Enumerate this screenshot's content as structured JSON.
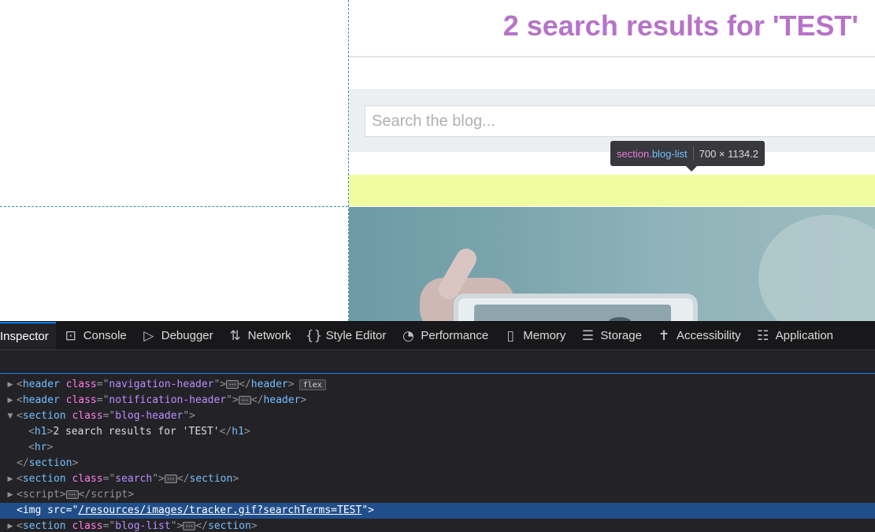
{
  "page": {
    "blog_title": "2 search results for 'TEST'",
    "search_placeholder": "Search the blog..."
  },
  "tooltip": {
    "tag": "section",
    "class": ".blog-list",
    "dimensions": "700 × 1134.2"
  },
  "devtools": {
    "tabs": [
      {
        "label": "Inspector",
        "icon": "inspector-icon",
        "active": true
      },
      {
        "label": "Console",
        "icon": "console-icon"
      },
      {
        "label": "Debugger",
        "icon": "debugger-icon"
      },
      {
        "label": "Network",
        "icon": "network-icon"
      },
      {
        "label": "Style Editor",
        "icon": "style-editor-icon"
      },
      {
        "label": "Performance",
        "icon": "performance-icon"
      },
      {
        "label": "Memory",
        "icon": "memory-icon"
      },
      {
        "label": "Storage",
        "icon": "storage-icon"
      },
      {
        "label": "Accessibility",
        "icon": "accessibility-icon"
      },
      {
        "label": "Application",
        "icon": "application-icon"
      }
    ],
    "markup": {
      "nav_header": {
        "tag": "header",
        "attr": "class",
        "value": "navigation-header",
        "badge": "flex"
      },
      "notif_header": {
        "tag": "header",
        "attr": "class",
        "value": "notification-header"
      },
      "blog_header": {
        "tag": "section",
        "attr": "class",
        "value": "blog-header"
      },
      "h1": {
        "tag": "h1",
        "text": "2 search results for 'TEST'"
      },
      "hr": {
        "tag": "hr"
      },
      "section_close": "section",
      "search_section": {
        "tag": "section",
        "attr": "class",
        "value": "search"
      },
      "script": {
        "tag": "script"
      },
      "img": {
        "tag": "img",
        "attr": "src",
        "value": "/resources/images/tracker.gif?searchTerms=TEST"
      },
      "blog_list": {
        "tag": "section",
        "attr": "class",
        "value": "blog-list"
      }
    }
  },
  "colors": {
    "title": "#b673c8",
    "highlight": "#f0fca0",
    "selected_row": "#204e8a",
    "active_tab": "#0a84ff"
  }
}
